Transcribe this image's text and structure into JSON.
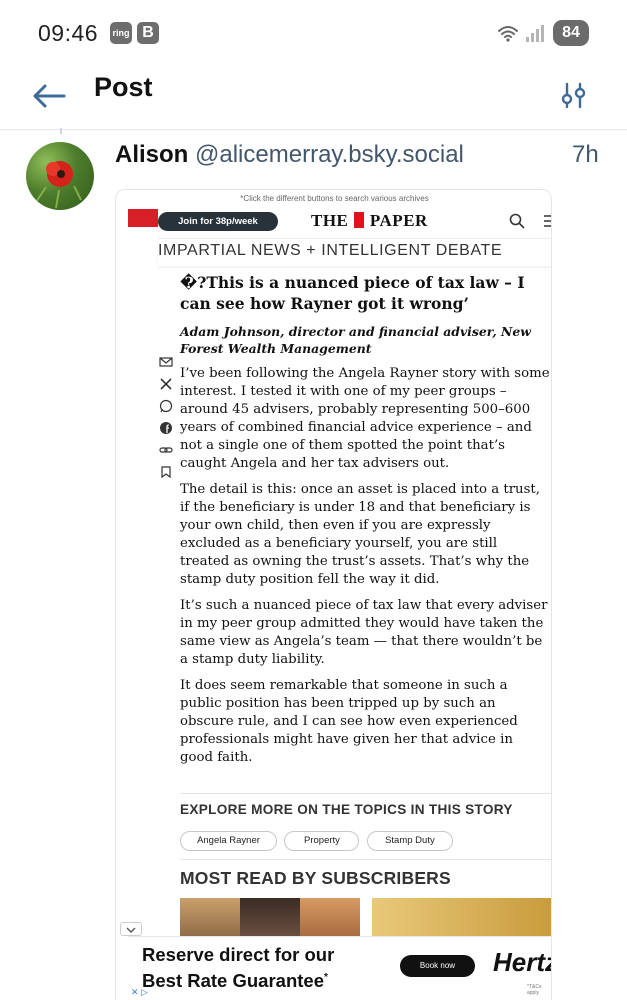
{
  "status_bar": {
    "time": "09:46",
    "ring_badge": "ring",
    "b_badge": "B",
    "battery": "84",
    "icons": [
      "wifi-icon",
      "signal-icon"
    ]
  },
  "header": {
    "title": "Post",
    "back_icon": "arrow-left-icon",
    "filter_icon": "sliders-icon"
  },
  "post": {
    "display_name": "Alison",
    "handle": "@alicemerray.bsky.social",
    "time_ago": "7h",
    "avatar_icon": "poppy-avatar"
  },
  "embed": {
    "archive_note": "*Click the different buttons to search various archives",
    "join_button": "Join for 38p/week",
    "logo_left": "THE",
    "logo_right": "PAPER",
    "tagline": "IMPARTIAL NEWS + INTELLIGENT DEBATE",
    "headline": "�?This is a nuanced piece of tax law – I can see how Rayner got it wrong’",
    "byline": "Adam Johnson, director and financial adviser, New Forest Wealth Management",
    "paragraphs": [
      "I’ve been following the Angela Rayner story with some interest. I tested it with one of my peer groups – around 45 advisers, probably representing 500–600 years of combined financial advice experience – and not a single one of them spotted the point that’s caught Angela and her tax advisers out.",
      "The detail is this: once an asset is placed into a trust, if the beneficiary is under 18 and that beneficiary is your own child, then even if you are expressly excluded as a beneficiary yourself, you are still treated as owning the trust’s assets. That’s why the stamp duty position fell the way it did.",
      "It’s such a nuanced piece of tax law that every adviser in my peer group admitted they would have taken the same view as Angela’s team — that there wouldn’t be a stamp duty liability.",
      "It does seem remarkable that someone in such a public position has been tripped up by such an obscure rule, and I can see how even experienced professionals might have given her that advice in good faith."
    ],
    "share_icons": [
      "mail-icon",
      "x-icon",
      "whatsapp-icon",
      "facebook-icon",
      "link-icon",
      "bookmark-icon"
    ],
    "explore_heading": "EXPLORE MORE ON THE TOPICS IN THIS STORY",
    "topics": [
      "Angela Rayner",
      "Property",
      "Stamp Duty"
    ],
    "most_read_heading": "MOST READ BY SUBSCRIBERS",
    "ad": {
      "line1": "Reserve direct for our",
      "line2": "Best Rate Guarantee",
      "line2_mark": "*",
      "button": "Book now",
      "brand": "Hertz",
      "note": "*T&Cs apply",
      "adchoices": "✕ ▷"
    }
  }
}
